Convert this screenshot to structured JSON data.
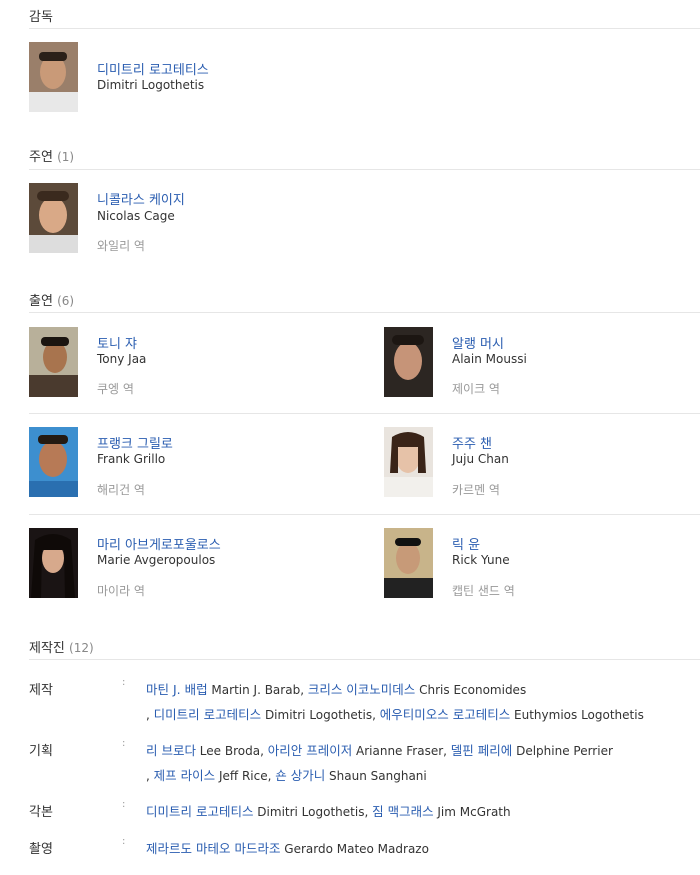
{
  "director": {
    "heading": "감독",
    "person": {
      "name_ko": "디미트리 로고테티스",
      "name_en": "Dimitri Logothetis"
    }
  },
  "lead": {
    "heading": "주연",
    "count": "(1)",
    "person": {
      "name_ko": "니콜라스 케이지",
      "name_en": "Nicolas Cage",
      "role": "와일리 역"
    }
  },
  "cast": {
    "heading": "출연",
    "count": "(6)",
    "people": [
      {
        "name_ko": "토니 쟈",
        "name_en": "Tony Jaa",
        "role": "쿠엥 역"
      },
      {
        "name_ko": "알랭 머시",
        "name_en": "Alain Moussi",
        "role": "제이크 역"
      },
      {
        "name_ko": "프랭크 그릴로",
        "name_en": "Frank Grillo",
        "role": "해리건 역"
      },
      {
        "name_ko": "주주 챈",
        "name_en": "Juju Chan",
        "role": "카르멘 역"
      },
      {
        "name_ko": "마리 아브게로포울로스",
        "name_en": "Marie Avgeropoulos",
        "role": "마이라 역"
      },
      {
        "name_ko": "릭 윤",
        "name_en": "Rick Yune",
        "role": "캡틴 샌드 역"
      }
    ]
  },
  "crew": {
    "heading": "제작진",
    "count": "(12)",
    "colon": ":",
    "rows": [
      {
        "label": "제작",
        "lines": [
          [
            {
              "ko": "마틴 J. 배럽",
              "en": "Martin J. Barab"
            },
            {
              "ko": "크리스 이코노미데스",
              "en": "Chris Economides"
            }
          ],
          [
            {
              "ko": "디미트리 로고테티스",
              "en": "Dimitri Logothetis"
            },
            {
              "ko": "에우티미오스 로고테티스",
              "en": "Euthymios Logothetis"
            }
          ]
        ]
      },
      {
        "label": "기획",
        "lines": [
          [
            {
              "ko": "리 브로다",
              "en": "Lee Broda"
            },
            {
              "ko": "아리안 프레이저",
              "en": "Arianne Fraser"
            },
            {
              "ko": "델핀 페리에",
              "en": "Delphine Perrier"
            }
          ],
          [
            {
              "ko": "제프 라이스",
              "en": "Jeff Rice"
            },
            {
              "ko": "숀 상가니",
              "en": "Shaun Sanghani"
            }
          ]
        ]
      },
      {
        "label": "각본",
        "lines": [
          [
            {
              "ko": "디미트리 로고테티스",
              "en": "Dimitri Logothetis"
            },
            {
              "ko": "짐 맥그래스",
              "en": "Jim McGrath"
            }
          ]
        ]
      },
      {
        "label": "촬영",
        "lines": [
          [
            {
              "ko": "제라르도 마테오 마드라조",
              "en": "Gerardo Mateo Madrazo"
            }
          ]
        ]
      }
    ]
  }
}
